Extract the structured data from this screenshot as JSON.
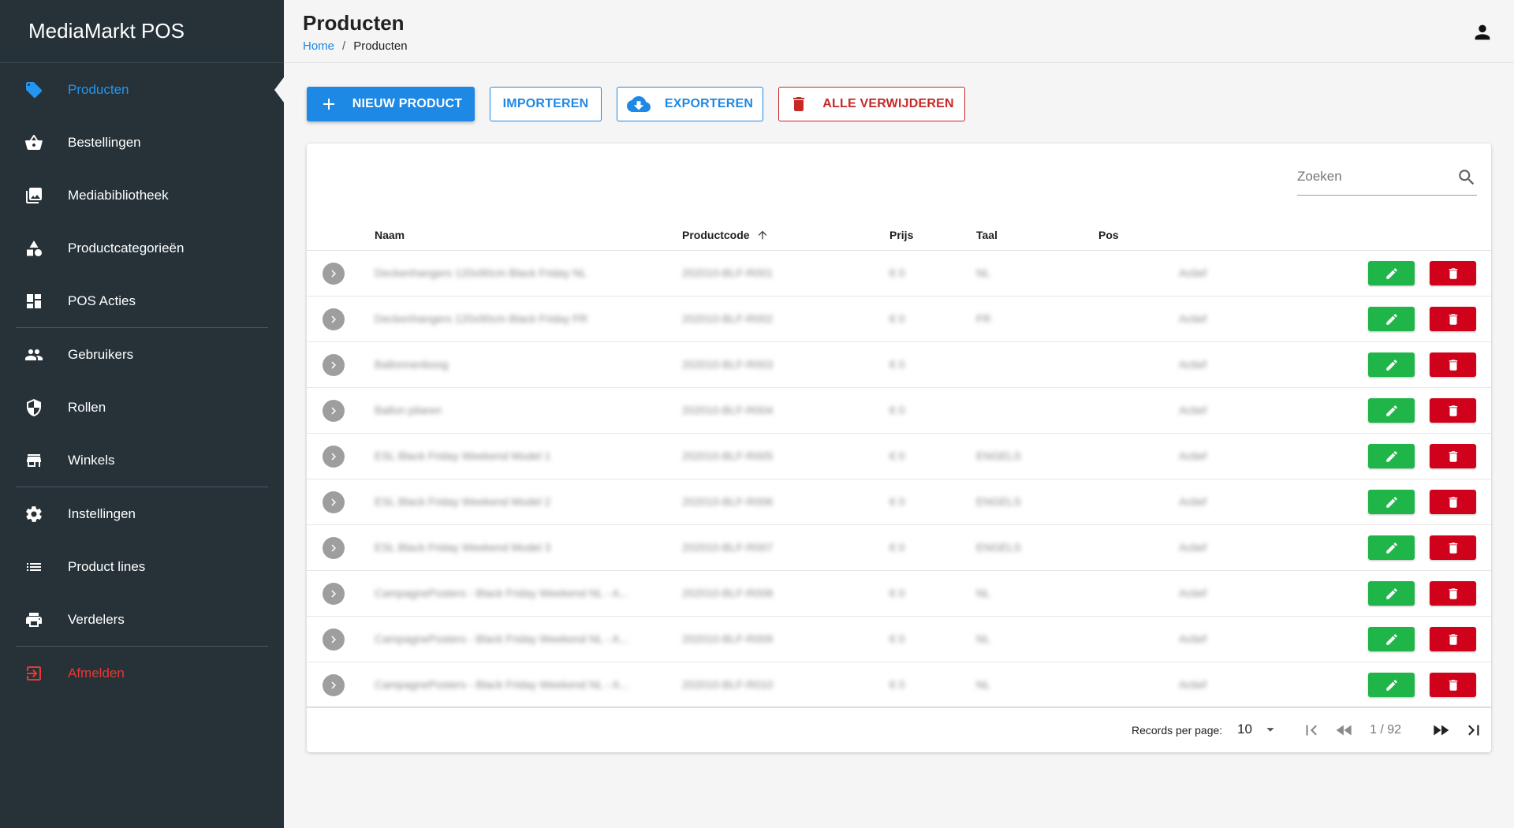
{
  "app": {
    "title": "MediaMarkt POS"
  },
  "sidebar": {
    "items": [
      {
        "label": "Producten",
        "icon": "tag-icon",
        "active": true
      },
      {
        "label": "Bestellingen",
        "icon": "basket-icon"
      },
      {
        "label": "Mediabibliotheek",
        "icon": "photo-library-icon"
      },
      {
        "label": "Productcategorieën",
        "icon": "category-icon"
      },
      {
        "label": "POS Acties",
        "icon": "dashboard-icon"
      },
      {
        "label": "Gebruikers",
        "icon": "people-icon"
      },
      {
        "label": "Rollen",
        "icon": "shield-icon"
      },
      {
        "label": "Winkels",
        "icon": "store-icon"
      },
      {
        "label": "Instellingen",
        "icon": "gear-icon"
      },
      {
        "label": "Product lines",
        "icon": "list-icon"
      },
      {
        "label": "Verdelers",
        "icon": "printer-icon"
      },
      {
        "label": "Afmelden",
        "icon": "logout-icon"
      }
    ]
  },
  "header": {
    "title": "Producten",
    "breadcrumb": {
      "home": "Home",
      "separator": "/",
      "current": "Producten"
    }
  },
  "toolbar": {
    "new_label": "NIEUW PRODUCT",
    "import_label": "IMPORTEREN",
    "export_label": "EXPORTEREN",
    "delete_all_label": "ALLE VERWIJDEREN"
  },
  "table": {
    "search_placeholder": "Zoeken",
    "columns": {
      "name": "Naam",
      "code": "Productcode",
      "price": "Prijs",
      "language": "Taal",
      "pos": "Pos"
    },
    "rows": [
      {
        "name": "Deckenhangers 120x90cm Black Friday NL",
        "code": "202010-BLF-R001",
        "price": "€ 0",
        "language": "NL",
        "status": "Actief"
      },
      {
        "name": "Deckenhangers 120x90cm Black Friday FR",
        "code": "202010-BLF-R002",
        "price": "€ 0",
        "language": "FR",
        "status": "Actief"
      },
      {
        "name": "Ballonnenboog",
        "code": "202010-BLF-R003",
        "price": "€ 0",
        "language": "",
        "status": "Actief"
      },
      {
        "name": "Ballon pilaren",
        "code": "202010-BLF-R004",
        "price": "€ 0",
        "language": "",
        "status": "Actief"
      },
      {
        "name": "ESL Black Friday Weekend Model 1",
        "code": "202010-BLF-R005",
        "price": "€ 0",
        "language": "ENGELS",
        "status": "Actief"
      },
      {
        "name": "ESL Black Friday Weekend Model 2",
        "code": "202010-BLF-R006",
        "price": "€ 0",
        "language": "ENGELS",
        "status": "Actief"
      },
      {
        "name": "ESL Black Friday Weekend Model 3",
        "code": "202010-BLF-R007",
        "price": "€ 0",
        "language": "ENGELS",
        "status": "Actief"
      },
      {
        "name": "CampagnePosters - Black Friday Weekend NL - A...",
        "code": "202010-BLF-R008",
        "price": "€ 0",
        "language": "NL",
        "status": "Actief"
      },
      {
        "name": "CampagnePosters - Black Friday Weekend NL - A...",
        "code": "202010-BLF-R009",
        "price": "€ 0",
        "language": "NL",
        "status": "Actief"
      },
      {
        "name": "CampagnePosters - Black Friday Weekend NL - A...",
        "code": "202010-BLF-R010",
        "price": "€ 0",
        "language": "NL",
        "status": "Actief"
      }
    ]
  },
  "pagination": {
    "records_label": "Records per page:",
    "records_value": "10",
    "page_info": "1 / 92"
  },
  "colors": {
    "sidebar": "#263238",
    "accent": "#1e88e5",
    "danger": "#c62828",
    "edit": "#1fb548",
    "delete": "#d0021b"
  }
}
